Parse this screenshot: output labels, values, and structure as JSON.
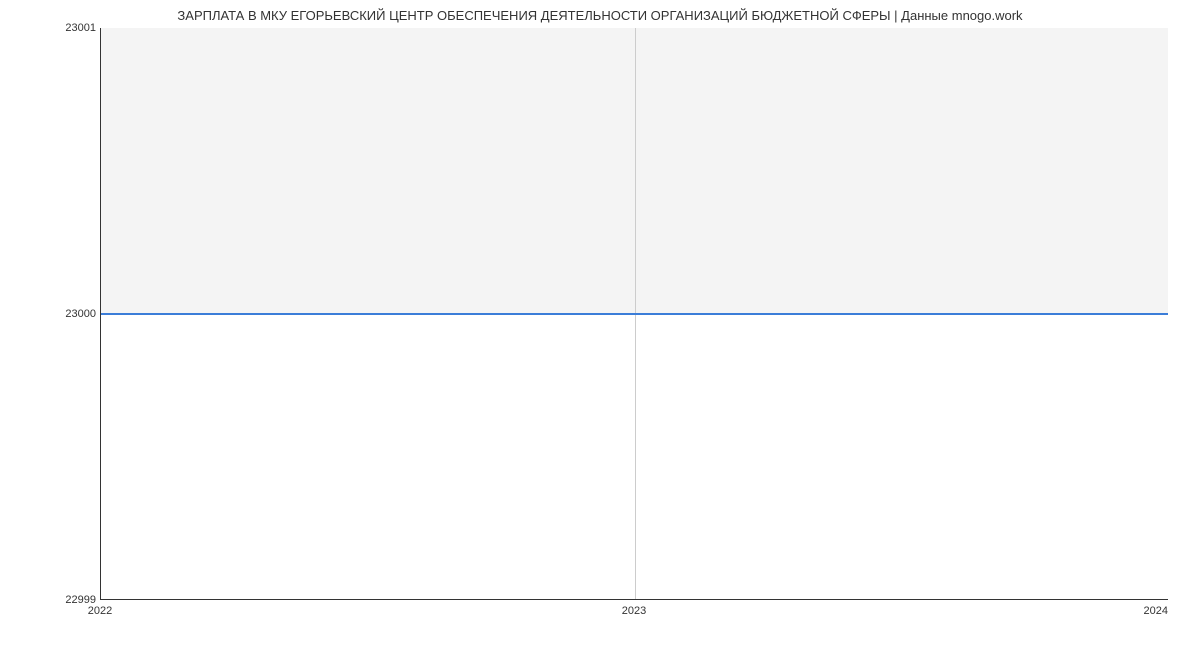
{
  "chart_data": {
    "type": "line",
    "title": "ЗАРПЛАТА В МКУ ЕГОРЬЕВСКИЙ ЦЕНТР ОБЕСПЕЧЕНИЯ ДЕЯТЕЛЬНОСТИ ОРГАНИЗАЦИЙ БЮДЖЕТНОЙ СФЕРЫ | Данные mnogo.work",
    "x": [
      2022,
      2023,
      2024
    ],
    "values": [
      23000,
      23000,
      23000
    ],
    "xlabel": "",
    "ylabel": "",
    "xlim": [
      2022,
      2024
    ],
    "ylim": [
      22999,
      23001
    ],
    "x_ticks": [
      "2022",
      "2023",
      "2024"
    ],
    "y_ticks": [
      "22999",
      "23000",
      "23001"
    ],
    "line_color": "#3b7dd8"
  }
}
